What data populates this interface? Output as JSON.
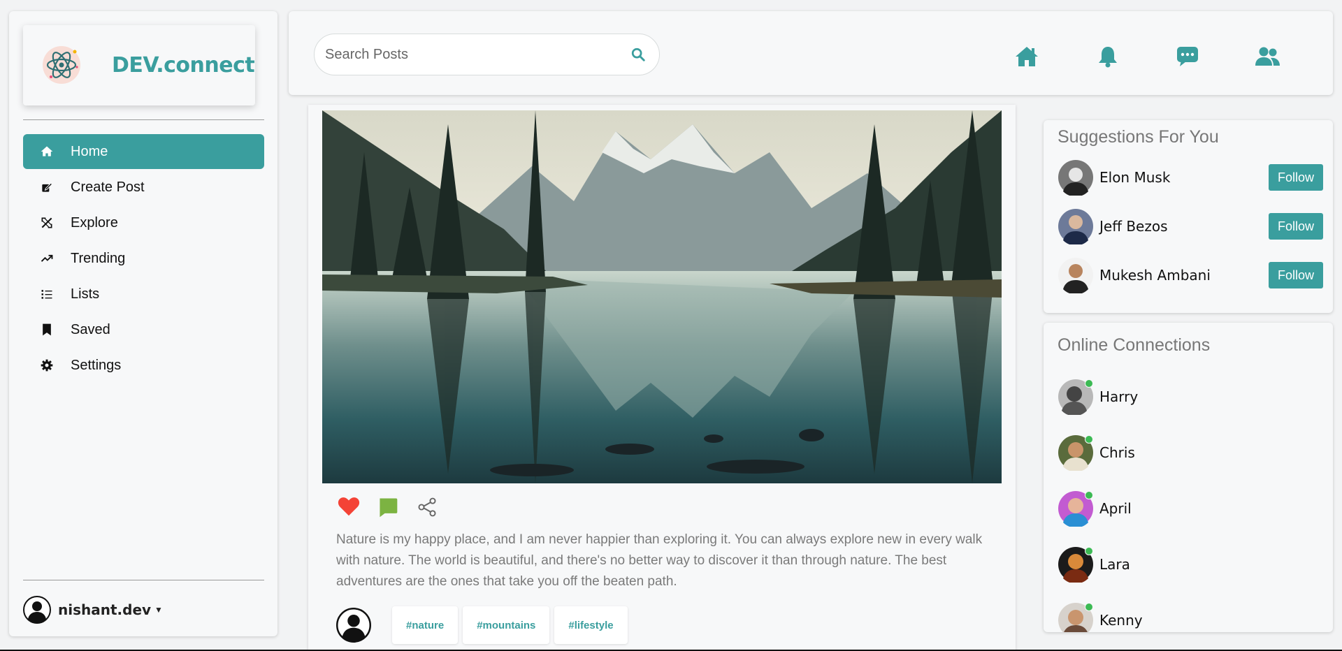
{
  "app": {
    "brand": "DEV.connect",
    "accent_color": "#3a9e9e",
    "logo_icon": "atom-icon"
  },
  "sidebar": {
    "items": [
      {
        "label": "Home",
        "icon": "home-icon",
        "active": true
      },
      {
        "label": "Create Post",
        "icon": "create-post-icon",
        "active": false
      },
      {
        "label": "Explore",
        "icon": "explore-icon",
        "active": false
      },
      {
        "label": "Trending",
        "icon": "trending-icon",
        "active": false
      },
      {
        "label": "Lists",
        "icon": "list-icon",
        "active": false
      },
      {
        "label": "Saved",
        "icon": "bookmark-icon",
        "active": false
      },
      {
        "label": "Settings",
        "icon": "gear-icon",
        "active": false
      }
    ],
    "user": {
      "name": "nishant.dev",
      "caret": "▼"
    }
  },
  "header": {
    "search_placeholder": "Search Posts",
    "search_icon": "search-icon",
    "icons": [
      "home-icon",
      "bell-icon",
      "chat-icon",
      "users-icon"
    ]
  },
  "post": {
    "image_description_icon": "landscape-image",
    "actions": {
      "like_color": "#f44336",
      "comment_color": "#7cb342"
    },
    "text": "Nature is my happy place, and I am never happier than exploring it. You can always explore new in every walk with nature. The world is beautiful, and there's no better way to discover it than through nature. The best adventures are the ones that take you off the beaten path.",
    "tags": [
      "#nature",
      "#mountains",
      "#lifestyle"
    ]
  },
  "suggestions": {
    "title": "Suggestions For You",
    "follow_label": "Follow",
    "people": [
      {
        "name": "Elon Musk"
      },
      {
        "name": "Jeff Bezos"
      },
      {
        "name": "Mukesh Ambani"
      }
    ]
  },
  "online": {
    "title": "Online Connections",
    "status_color": "#3cba54",
    "people": [
      {
        "name": "Harry"
      },
      {
        "name": "Chris"
      },
      {
        "name": "April"
      },
      {
        "name": "Lara"
      },
      {
        "name": "Kenny"
      }
    ]
  }
}
